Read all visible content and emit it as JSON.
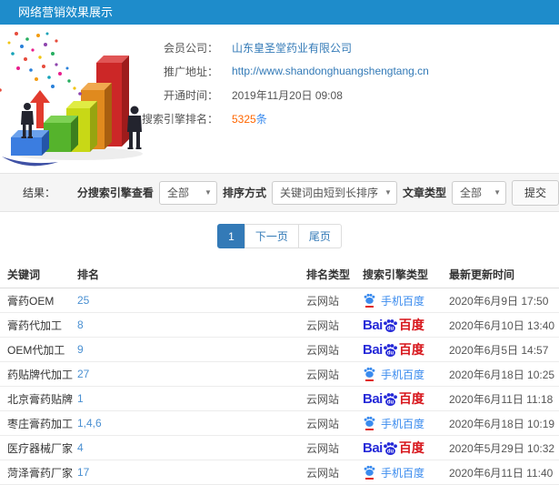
{
  "header": {
    "title": "网络营销效果展示"
  },
  "info": {
    "rows": [
      {
        "label": "会员公司：",
        "value": "山东皇圣堂药业有限公司"
      },
      {
        "label": "推广地址：",
        "value": "http://www.shandonghuangshengtang.cn"
      },
      {
        "label": "开通时间：",
        "value": "2019年11月20日 09:08"
      },
      {
        "label": "搜索引擎排名：",
        "value": "5325",
        "unit": "条"
      }
    ]
  },
  "filters": {
    "result_label": "结果：",
    "engine_label": "分搜索引擎查看",
    "engine_value": "全部",
    "sort_label": "排序方式",
    "sort_value": "关键词由短到长排序",
    "article_label": "文章类型",
    "article_value": "全部",
    "submit_label": "提交",
    "caret": "▼"
  },
  "pagination": {
    "current": "1",
    "next": "下一页",
    "last": "尾页"
  },
  "table": {
    "headers": [
      "关键词",
      "排名",
      "排名类型",
      "搜索引擎类型",
      "最新更新时间"
    ],
    "rows": [
      {
        "keyword": "膏药OEM",
        "rank": "25",
        "rank_type": "云网站",
        "engine": {
          "type": "mobile",
          "label": "手机百度"
        },
        "updated": "2020年6月9日 17:50"
      },
      {
        "keyword": "膏药代加工",
        "rank": "8",
        "rank_type": "云网站",
        "engine": {
          "type": "pc",
          "bai": "Bai",
          "du": "du",
          "cn": "百度"
        },
        "updated": "2020年6月10日 13:40"
      },
      {
        "keyword": "OEM代加工",
        "rank": "9",
        "rank_type": "云网站",
        "engine": {
          "type": "pc",
          "bai": "Bai",
          "du": "du",
          "cn": "百度"
        },
        "updated": "2020年6月5日 14:57"
      },
      {
        "keyword": "药贴牌代加工",
        "rank": "27",
        "rank_type": "云网站",
        "engine": {
          "type": "mobile",
          "label": "手机百度"
        },
        "updated": "2020年6月18日 10:25"
      },
      {
        "keyword": "北京膏药贴牌",
        "rank": "1",
        "rank_type": "云网站",
        "engine": {
          "type": "pc",
          "bai": "Bai",
          "du": "du",
          "cn": "百度"
        },
        "updated": "2020年6月11日 11:18"
      },
      {
        "keyword": "枣庄膏药加工",
        "rank": "1,4,6",
        "rank_type": "云网站",
        "engine": {
          "type": "mobile",
          "label": "手机百度"
        },
        "updated": "2020年6月18日 10:19"
      },
      {
        "keyword": "医疗器械厂家",
        "rank": "4",
        "rank_type": "云网站",
        "engine": {
          "type": "pc",
          "bai": "Bai",
          "du": "du",
          "cn": "百度"
        },
        "updated": "2020年5月29日 10:32"
      },
      {
        "keyword": "菏泽膏药厂家",
        "rank": "17",
        "rank_type": "云网站",
        "engine": {
          "type": "mobile",
          "label": "手机百度"
        },
        "updated": "2020年6月11日 11:40"
      }
    ]
  },
  "colors": {
    "header_bg": "#1e8ccb",
    "link": "#337ab7",
    "count_orange": "#ff6600",
    "baidu_blue": "#2529d8",
    "baidu_red": "#d7141a",
    "mobile_baidu_blue": "#3a8bee",
    "pagination_active": "#337ab7"
  },
  "promo_image": {
    "description": "3d-ascending-bar-chart-with-two-businessmen-red-arrow-and-confetti",
    "bar_colors": [
      "#3b7de0",
      "#55b32c",
      "#c8d816",
      "#e08a1e",
      "#cc2727"
    ],
    "arrow_color": "#e23b2e"
  }
}
